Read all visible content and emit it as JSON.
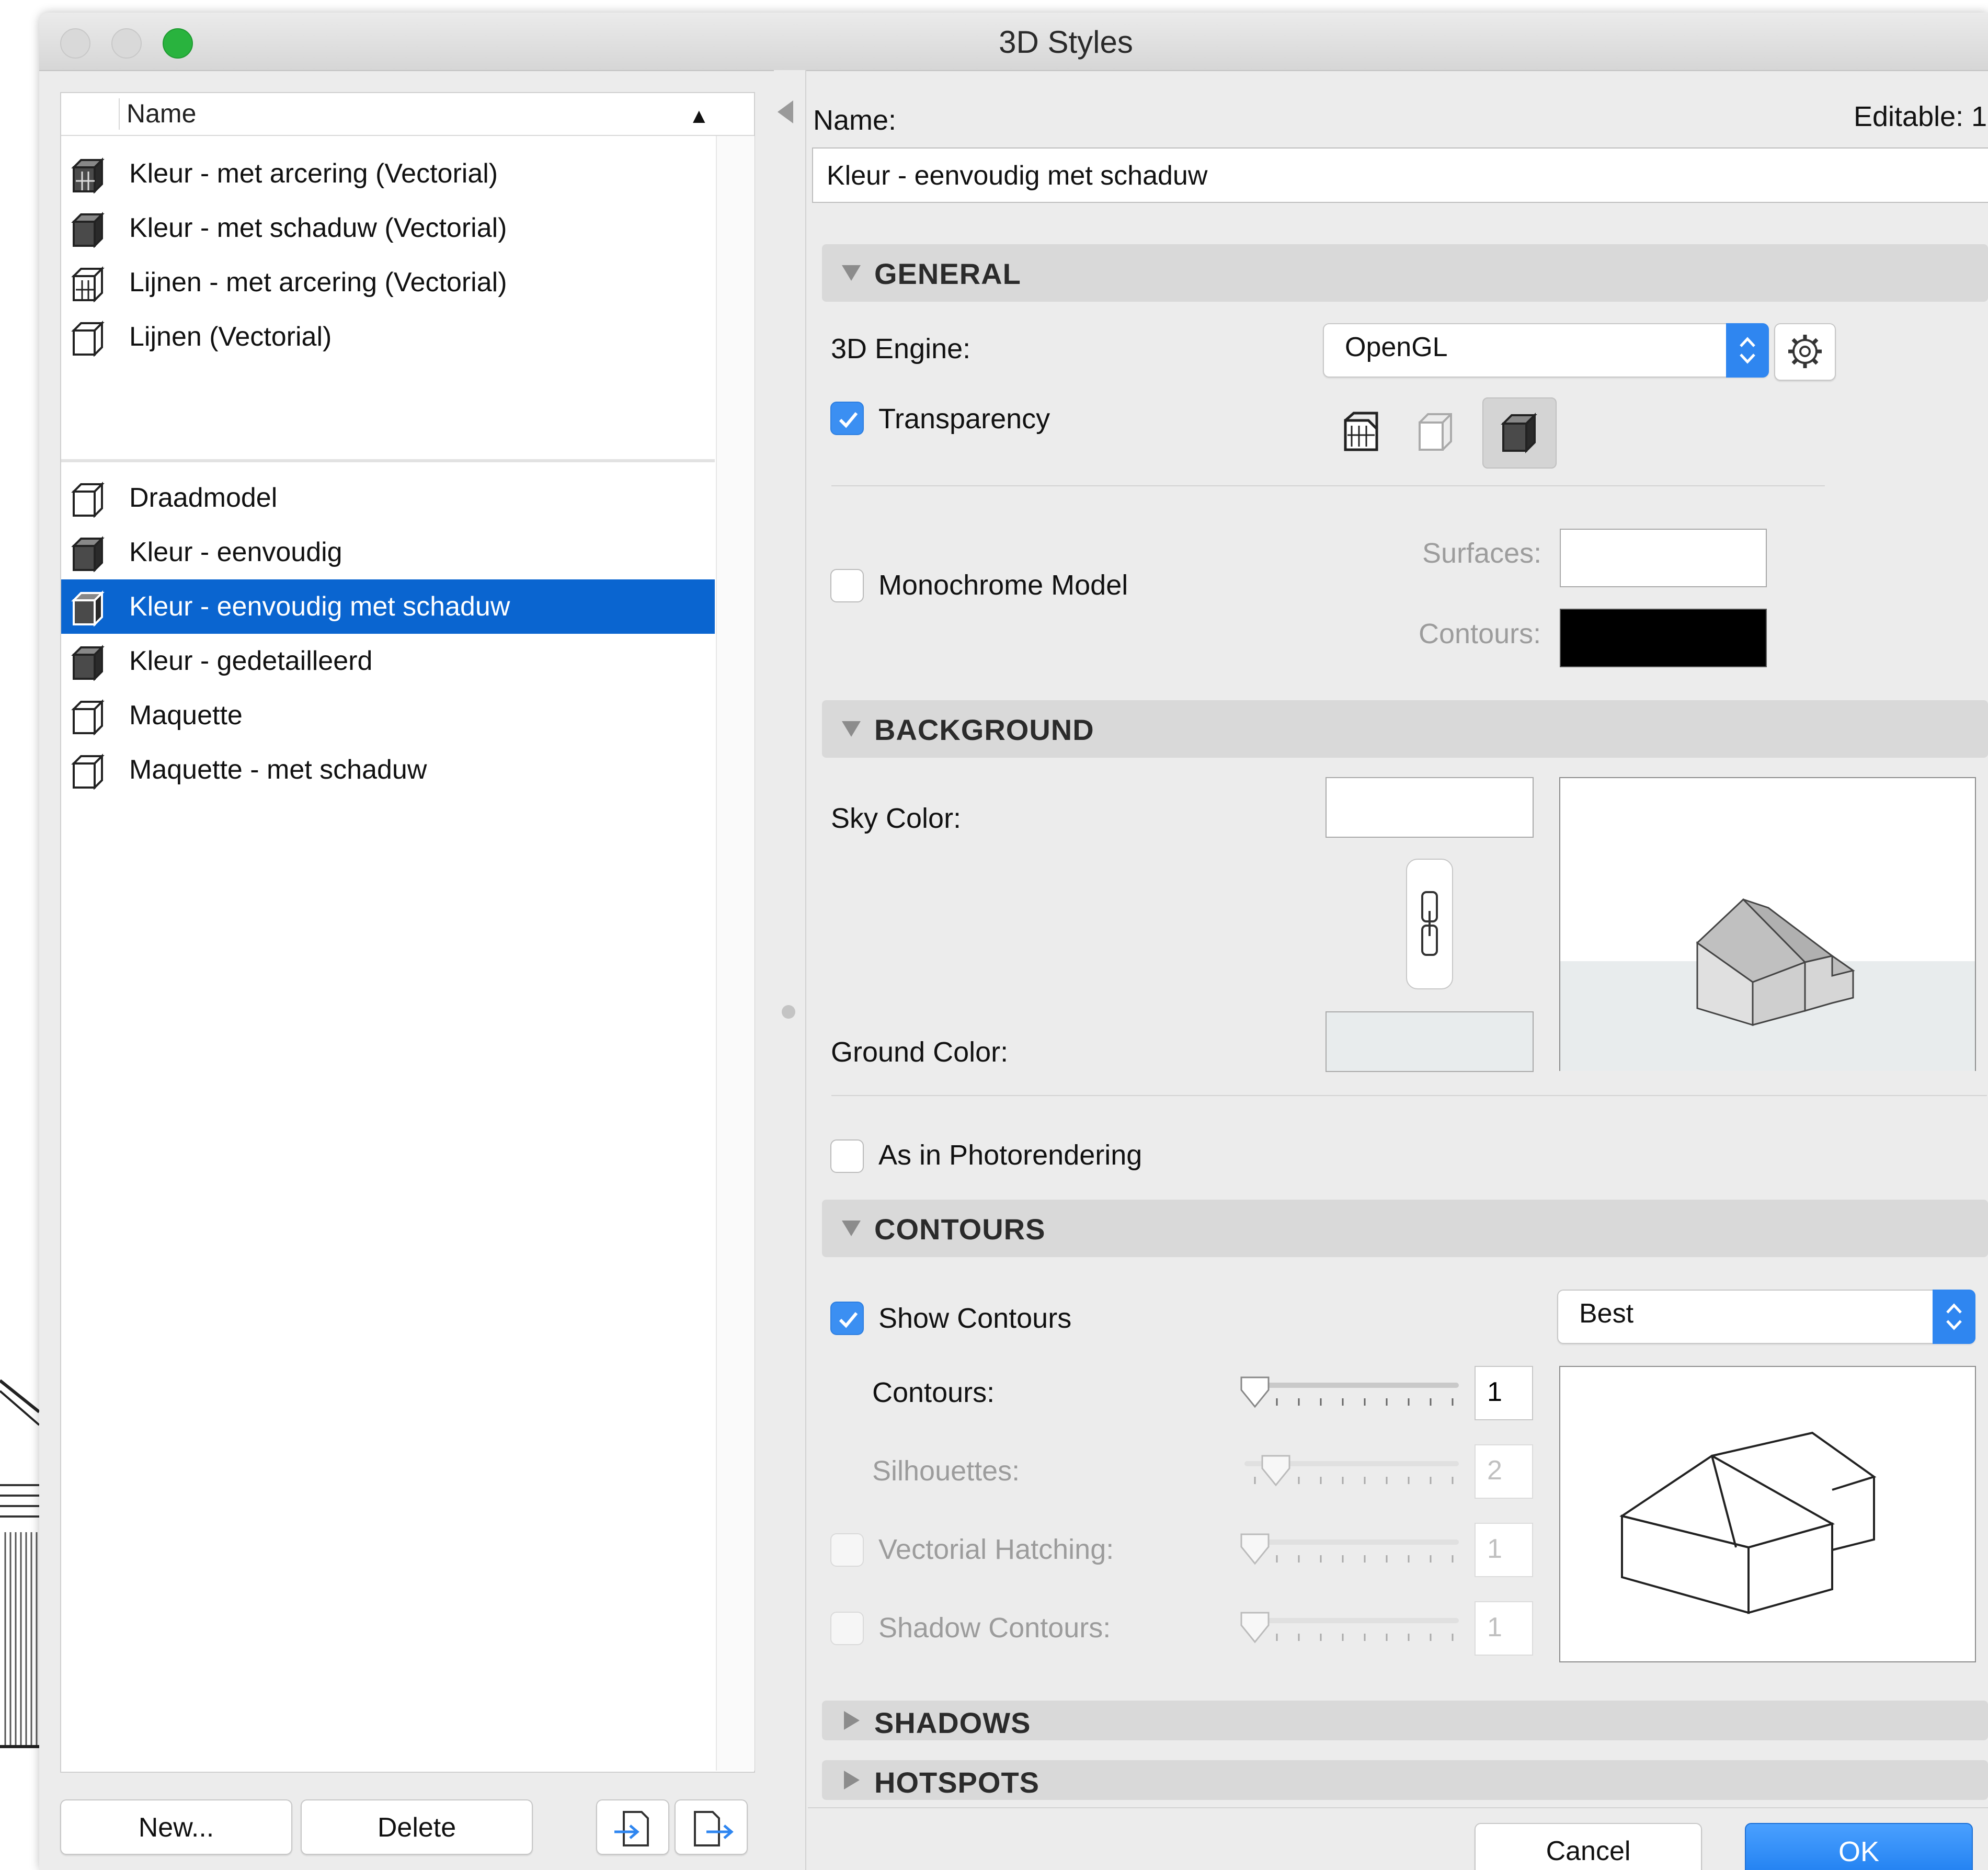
{
  "window": {
    "title": "3D Styles"
  },
  "list": {
    "column_header": "Name",
    "group1": [
      {
        "label": "Kleur - met arcering (Vectorial)",
        "icon": "color-hatched-style-icon"
      },
      {
        "label": "Kleur - met schaduw (Vectorial)",
        "icon": "color-shadow-style-icon"
      },
      {
        "label": "Lijnen - met arcering (Vectorial)",
        "icon": "lines-hatched-style-icon"
      },
      {
        "label": "Lijnen (Vectorial)",
        "icon": "lines-style-icon"
      }
    ],
    "group2": [
      {
        "label": "Draadmodel",
        "icon": "wireframe-style-icon"
      },
      {
        "label": "Kleur - eenvoudig",
        "icon": "color-simple-style-icon"
      },
      {
        "label": "Kleur - eenvoudig met schaduw",
        "icon": "color-simple-shadow-style-icon",
        "selected": true
      },
      {
        "label": "Kleur - gedetailleerd",
        "icon": "color-detailed-style-icon"
      },
      {
        "label": "Maquette",
        "icon": "maquette-style-icon"
      },
      {
        "label": "Maquette - met schaduw",
        "icon": "maquette-shadow-style-icon"
      }
    ]
  },
  "buttons": {
    "new": "New...",
    "delete": "Delete",
    "cancel": "Cancel",
    "ok": "OK"
  },
  "details": {
    "name_label": "Name:",
    "editable_label": "Editable: 1",
    "name_value": "Kleur - eenvoudig met schaduw"
  },
  "general": {
    "title": "GENERAL",
    "engine_label": "3D Engine:",
    "engine_value": "OpenGL",
    "transparency_label": "Transparency",
    "transparency_checked": true,
    "monochrome_label": "Monochrome Model",
    "monochrome_checked": false,
    "surfaces_label": "Surfaces:",
    "contours_label": "Contours:",
    "surfaces_color": "#ffffff",
    "contours_color": "#000000"
  },
  "background": {
    "title": "BACKGROUND",
    "sky_label": "Sky Color:",
    "ground_label": "Ground Color:",
    "sky_color": "#ffffff",
    "ground_color": "#e8eced",
    "photorender_label": "As in Photorendering",
    "photorender_checked": false
  },
  "contours": {
    "title": "CONTOURS",
    "show_label": "Show Contours",
    "show_checked": true,
    "quality_value": "Best",
    "rows": [
      {
        "label": "Contours:",
        "value": "1",
        "enabled": true
      },
      {
        "label": "Silhouettes:",
        "value": "2",
        "enabled": false
      },
      {
        "label": "Vectorial Hatching:",
        "value": "1",
        "enabled": false
      },
      {
        "label": "Shadow Contours:",
        "value": "1",
        "enabled": false
      }
    ]
  },
  "shadows": {
    "title": "SHADOWS"
  },
  "hotspots": {
    "title": "HOTSPOTS"
  },
  "colors": {
    "accent": "#2f86f0",
    "selection": "#0a65d0"
  }
}
